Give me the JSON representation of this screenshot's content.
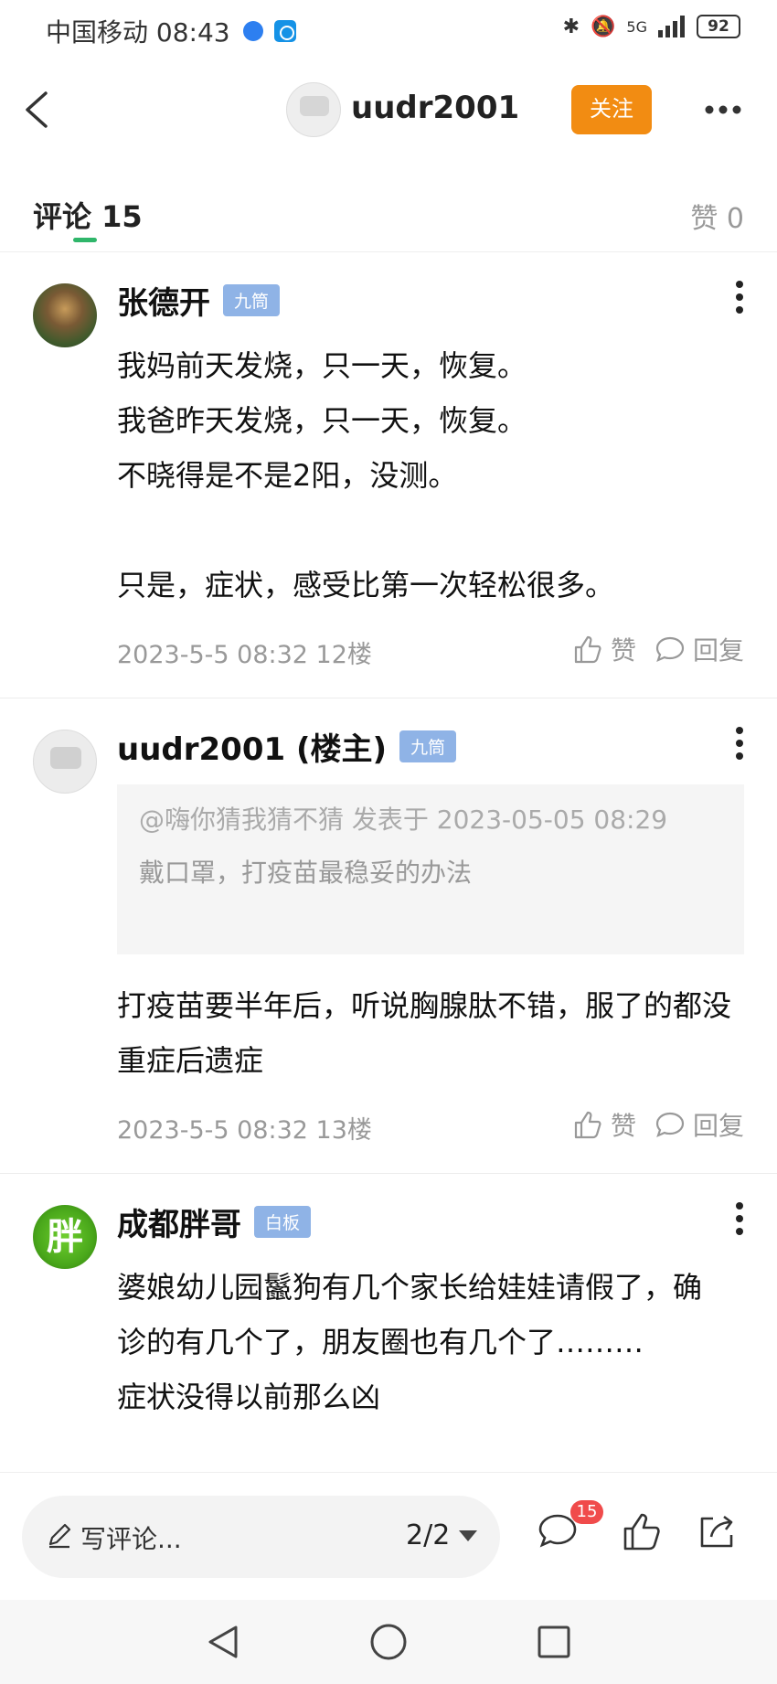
{
  "status_bar": {
    "carrier_time": "中国移动 08:43",
    "network": "5G",
    "battery": "92"
  },
  "header": {
    "title": "uudr2001",
    "follow_label": "关注"
  },
  "tabs": {
    "comments_label": "评论",
    "comments_count": "15",
    "likes_label": "赞 0"
  },
  "comments": [
    {
      "author": "张德开",
      "tag": "九筒",
      "body": "我妈前天发烧，只一天，恢复。\n我爸昨天发烧，只一天，恢复。\n不晓得是不是2阳，没测。\n\n只是，症状，感受比第一次轻松很多。",
      "meta": "2023-5-5 08:32  12楼",
      "like_label": "赞",
      "reply_label": "回复"
    },
    {
      "author": "uudr2001 (楼主)",
      "tag": "九筒",
      "quote_head": "@嗨你猜我猜不猜 发表于 2023-05-05 08:29",
      "quote_text": "戴口罩，打疫苗最稳妥的办法",
      "body": "打疫苗要半年后，听说胸腺肽不错，服了的都没重症后遗症",
      "meta": "2023-5-5 08:32  13楼",
      "like_label": "赞",
      "reply_label": "回复"
    },
    {
      "author": "成都胖哥",
      "tag": "白板",
      "avatar_char": "胖",
      "body": "婆娘幼儿园鬣狗有几个家长给娃娃请假了，确诊的有几个了，朋友圈也有几个了………\n症状没得以前那么凶"
    }
  ],
  "bottom_bar": {
    "input_placeholder": "写评论...",
    "page_indicator": "2/2",
    "comment_badge": "15"
  }
}
